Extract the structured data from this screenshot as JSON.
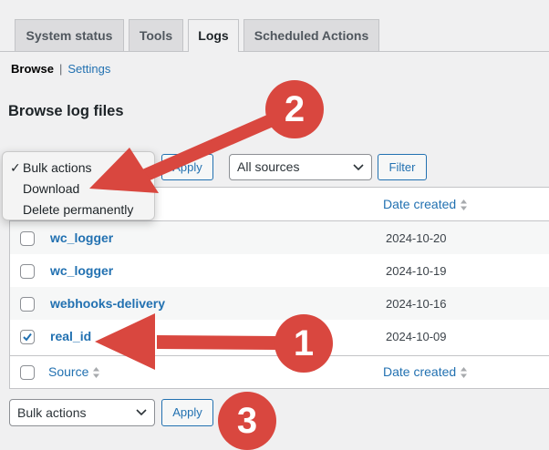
{
  "tabs": [
    {
      "label": "System status"
    },
    {
      "label": "Tools"
    },
    {
      "label": "Logs"
    },
    {
      "label": "Scheduled Actions"
    }
  ],
  "subnav": {
    "browse": "Browse",
    "separator": "|",
    "settings": "Settings"
  },
  "page_title": "Browse log files",
  "bulk_menu": {
    "options": [
      {
        "label": "Bulk actions",
        "checked": true
      },
      {
        "label": "Download",
        "checked": false
      },
      {
        "label": "Delete permanently",
        "checked": false
      }
    ]
  },
  "top_controls": {
    "apply_label": "Apply",
    "source_value": "All sources",
    "filter_label": "Filter"
  },
  "table": {
    "date_header": "Date created",
    "source_header": "Source",
    "rows": [
      {
        "name": "wc_logger",
        "date": "2024-10-20",
        "checked": false
      },
      {
        "name": "wc_logger",
        "date": "2024-10-19",
        "checked": false
      },
      {
        "name": "webhooks-delivery",
        "date": "2024-10-16",
        "checked": false
      },
      {
        "name": "real_id",
        "date": "2024-10-09",
        "checked": true
      }
    ]
  },
  "bottom_controls": {
    "bulk_value": "Bulk actions",
    "apply_label": "Apply"
  },
  "annotations": {
    "step1": "1",
    "step2": "2",
    "step3": "3"
  },
  "colors": {
    "accent": "#2271b1",
    "annotation": "#d9473f",
    "background": "#f0f0f1"
  }
}
